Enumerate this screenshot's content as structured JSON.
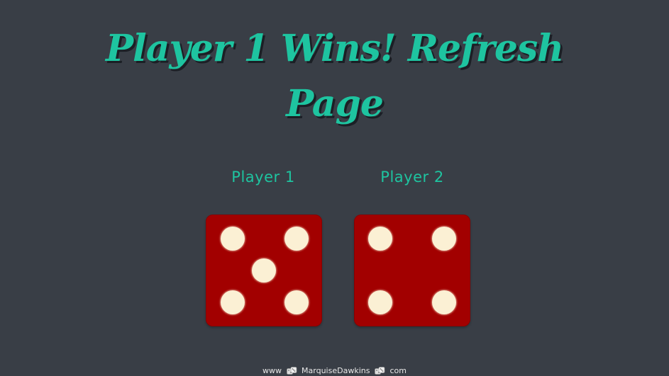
{
  "title": {
    "line1": "Player 1 Wins! Refresh",
    "line2": "Page"
  },
  "players": [
    {
      "label": "Player 1",
      "die_value": 5
    },
    {
      "label": "Player 2",
      "die_value": 4
    }
  ],
  "colors": {
    "background": "#393e46",
    "accent": "#1ec4a0",
    "die_face": "#a20000",
    "pip": "#fbf0d4"
  },
  "footer": {
    "prefix": "www",
    "name": "MarquiseDawkins",
    "suffix": "com",
    "separator_icon": "dice-icon"
  }
}
